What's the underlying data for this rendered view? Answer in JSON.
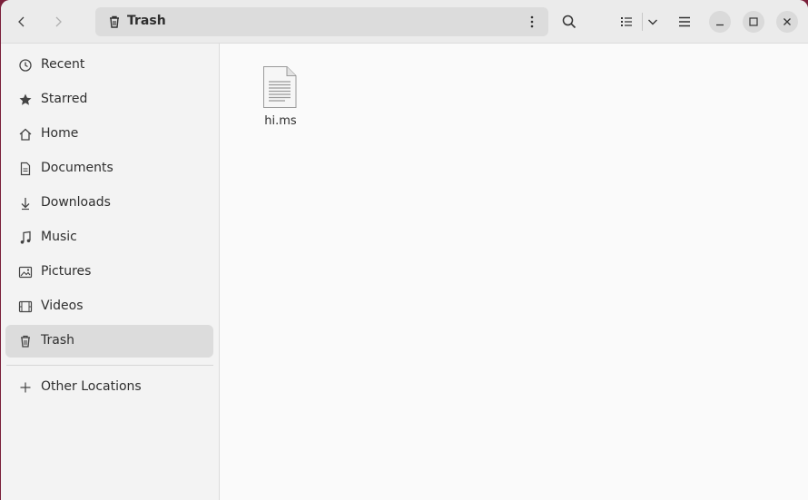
{
  "location": {
    "title": "Trash"
  },
  "sidebar": {
    "items": [
      {
        "label": "Recent",
        "icon": "clock-icon"
      },
      {
        "label": "Starred",
        "icon": "star-icon"
      },
      {
        "label": "Home",
        "icon": "home-icon"
      },
      {
        "label": "Documents",
        "icon": "document-icon"
      },
      {
        "label": "Downloads",
        "icon": "download-icon"
      },
      {
        "label": "Music",
        "icon": "music-icon"
      },
      {
        "label": "Pictures",
        "icon": "picture-icon"
      },
      {
        "label": "Videos",
        "icon": "video-icon"
      },
      {
        "label": "Trash",
        "icon": "trash-icon",
        "active": true
      }
    ],
    "other_locations": "Other Locations"
  },
  "files": [
    {
      "name": "hi.ms",
      "icon": "text-file-icon"
    }
  ],
  "colors": {
    "accent_bg": "#dcdcdc",
    "desktop": "#7a1f3a"
  }
}
